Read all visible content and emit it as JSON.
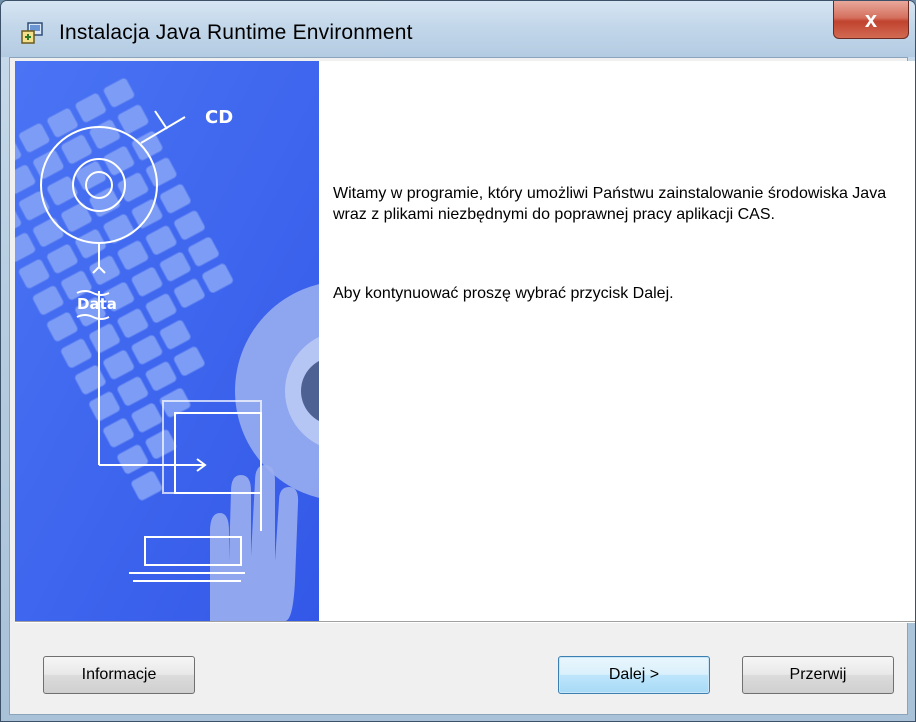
{
  "window": {
    "title": "Instalacja Java Runtime Environment",
    "close_glyph": "x"
  },
  "content": {
    "welcome_text": "Witamy w programie, który umożliwi Państwu zainstalowanie środowiska Java wraz z plikami niezbędnymi do poprawnej pracy aplikacji CAS.",
    "continue_text": "Aby kontynuować proszę wybrać przycisk Dalej."
  },
  "illustration": {
    "labels": {
      "cd": "CD",
      "data": "Data"
    },
    "icons": [
      "keyboard-illustration",
      "cd-disc-icon",
      "hand-illustration",
      "computer-outline-icon"
    ]
  },
  "buttons": {
    "info_label": "Informacje",
    "next_label": "Dalej >",
    "cancel_label": "Przerwij"
  },
  "colors": {
    "illustration_blue": "#3c66f2",
    "next_button_border": "#3c7fb1",
    "close_button": "#c0432e"
  }
}
